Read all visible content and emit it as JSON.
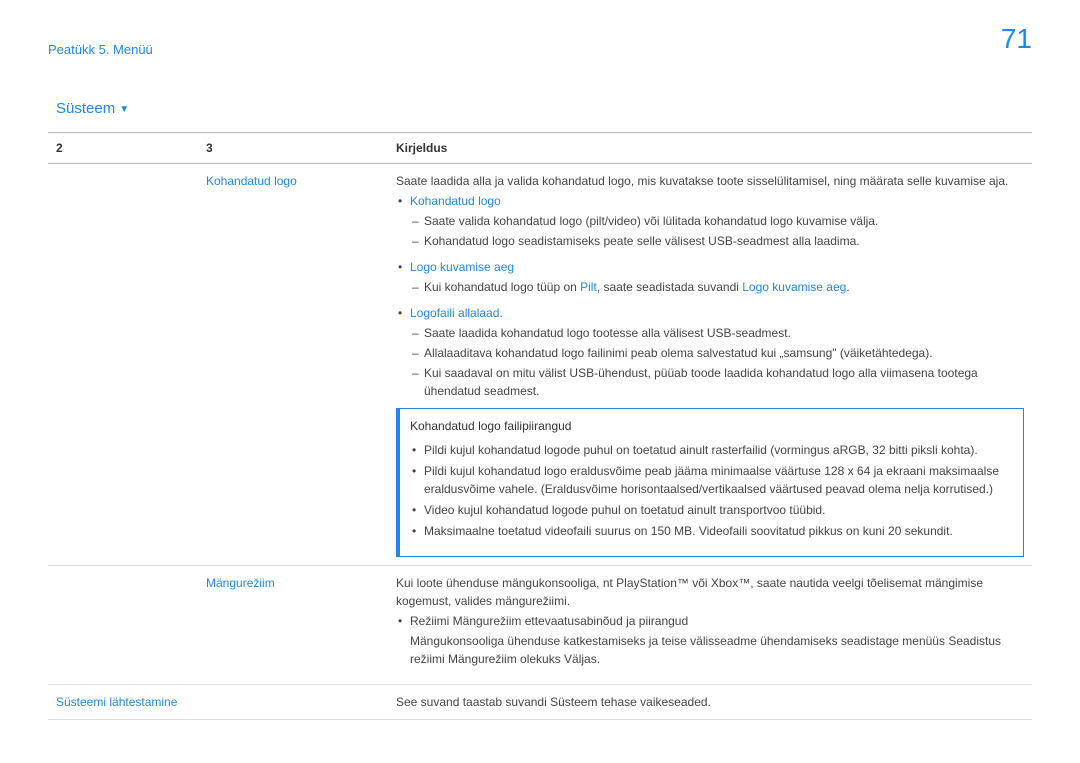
{
  "breadcrumb": "Peatükk 5. Menüü",
  "page_number": "71",
  "section": {
    "title": "Süsteem"
  },
  "headers": {
    "c2": "2",
    "c3": "3",
    "desc": "Kirjeldus"
  },
  "rows": {
    "r1": {
      "c3": "Kohandatud logo",
      "intro": "Saate laadida alla ja valida kohandatud logo, mis kuvatakse toote sisselülitamisel, ning määrata selle kuvamise aja.",
      "b1": "Kohandatud logo",
      "b1_s1": "Saate valida kohandatud logo (pilt/video) või lülitada kohandatud logo kuvamise välja.",
      "b1_s2": "Kohandatud logo seadistamiseks peate selle välisest USB-seadmest alla laadima.",
      "b2": "Logo kuvamise aeg",
      "b2_s1_pre": "Kui kohandatud logo tüüp on ",
      "b2_s1_pilt": "Pilt",
      "b2_s1_mid": ", saate seadistada suvandi ",
      "b2_s1_link": "Logo kuvamise aeg",
      "b2_s1_post": ".",
      "b3": "Logofaili allalaad.",
      "b3_s1": "Saate laadida kohandatud logo tootesse alla välisest USB-seadmest.",
      "b3_s2": "Allalaaditava kohandatud logo failinimi peab olema salvestatud kui „samsung\" (väiketähtedega).",
      "b3_s3": "Kui saadaval on mitu välist USB-ühendust, püüab toode laadida kohandatud logo alla viimasena tootega ühendatud seadmest.",
      "callout_title": "Kohandatud logo failipiirangud",
      "c_li1": "Pildi kujul kohandatud logode puhul on toetatud ainult rasterfailid (vormingus aRGB, 32 bitti piksli kohta).",
      "c_li2": "Pildi kujul kohandatud logo eraldusvõime peab jääma minimaalse väärtuse 128 x 64 ja ekraani maksimaalse eraldusvõime vahele. (Eraldusvõime horisontaalsed/vertikaalsed väärtused peavad olema nelja korrutised.)",
      "c_li3": "Video kujul kohandatud logode puhul on toetatud ainult transportvoo tüübid.",
      "c_li4": "Maksimaalne toetatud videofaili suurus on 150 MB. Videofaili soovitatud pikkus on kuni 20 sekundit."
    },
    "r2": {
      "c3": "Mängurežiim",
      "p1": "Kui loote ühenduse mängukonsooliga, nt PlayStation™ või Xbox™, saate nautida veelgi tõelisemat mängimise kogemust, valides mängurežiimi.",
      "li1": "Režiimi Mängurežiim ettevaatusabinõud ja piirangud",
      "li1_sub": "Mängukonsooliga ühenduse katkestamiseks ja teise välisseadme ühendamiseks seadistage menüüs Seadistus režiimi Mängurežiim olekuks Väljas."
    },
    "r3": {
      "c2": "Süsteemi lähtestamine",
      "desc": "See suvand taastab suvandi Süsteem tehase vaikeseaded."
    }
  }
}
